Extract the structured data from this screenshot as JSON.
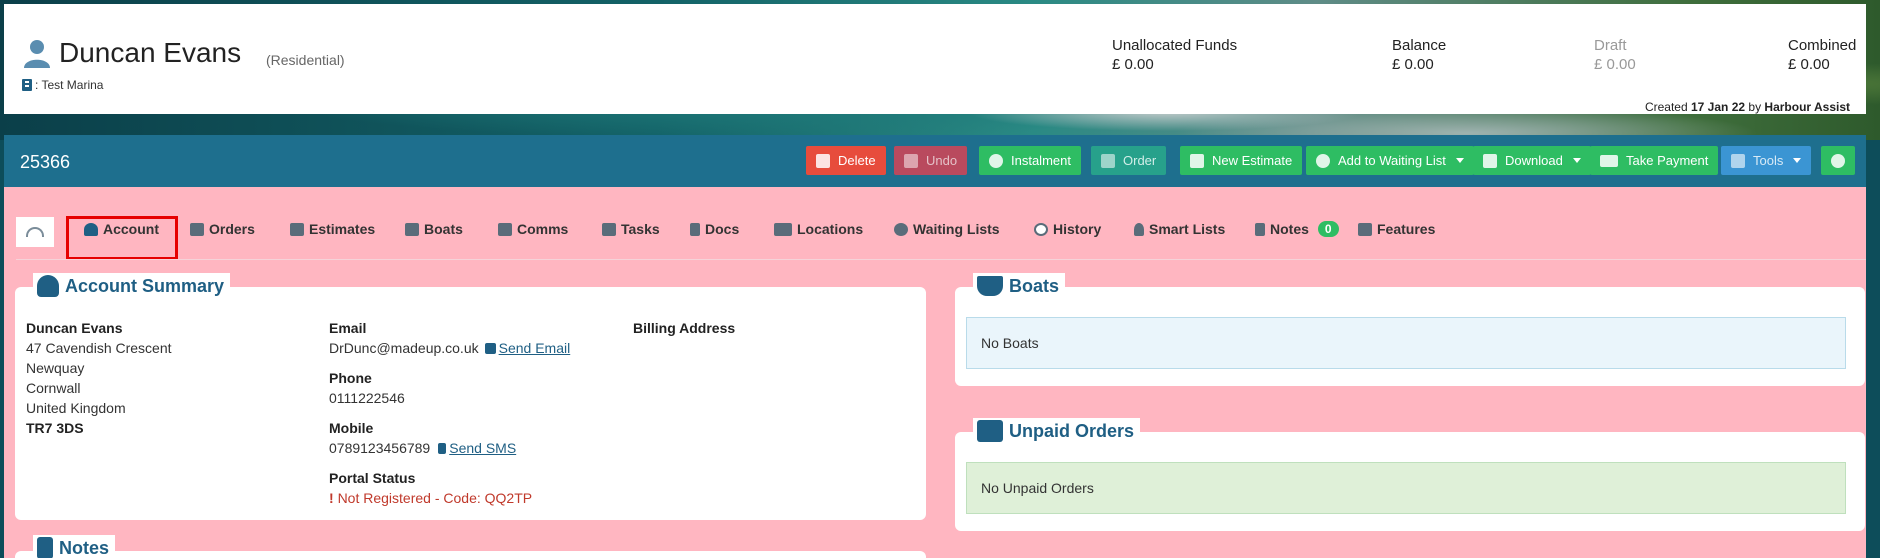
{
  "customer": {
    "name": "Duncan Evans",
    "type": "(Residential)",
    "marina": ": Test Marina"
  },
  "funds": [
    {
      "label": "Unallocated Funds",
      "value": "£ 0.00"
    },
    {
      "label": "Balance",
      "value": "£ 0.00"
    },
    {
      "label": "Draft",
      "value": "£ 0.00"
    },
    {
      "label": "Combined",
      "value": "£ 0.00"
    }
  ],
  "created": {
    "prefix": "Created",
    "date": "17 Jan 22",
    "by": "by",
    "author": "Harbour Assist"
  },
  "record_id": "25366",
  "actions": {
    "delete": "Delete",
    "undo": "Undo",
    "instalment": "Instalment",
    "order": "Order",
    "new_estimate": "New Estimate",
    "add_waiting_list": "Add to Waiting List",
    "download": "Download",
    "take_payment": "Take Payment",
    "tools": "Tools"
  },
  "tabs": {
    "account": "Account",
    "orders": "Orders",
    "estimates": "Estimates",
    "boats": "Boats",
    "comms": "Comms",
    "tasks": "Tasks",
    "docs": "Docs",
    "locations": "Locations",
    "waiting_lists": "Waiting Lists",
    "history": "History",
    "smart_lists": "Smart Lists",
    "notes": "Notes",
    "notes_count": "0",
    "features": "Features"
  },
  "account_summary": {
    "title": "Account Summary",
    "name": "Duncan Evans",
    "address": [
      "47 Cavendish Crescent",
      "Newquay",
      "Cornwall",
      "United Kingdom"
    ],
    "postcode": "TR7 3DS",
    "email_label": "Email",
    "email": "DrDunc@madeup.co.uk",
    "send_email": "Send Email",
    "phone_label": "Phone",
    "phone": "0111222546",
    "mobile_label": "Mobile",
    "mobile": "0789123456789",
    "send_sms": "Send SMS",
    "portal_label": "Portal Status",
    "portal_status": "Not Registered - Code: QQ2TP",
    "billing_label": "Billing Address"
  },
  "boats_panel": {
    "title": "Boats",
    "empty": "No Boats"
  },
  "unpaid_panel": {
    "title": "Unpaid Orders",
    "empty": "No Unpaid Orders"
  },
  "notes_panel": {
    "title": "Notes"
  },
  "colors": {
    "action_bar": "#1e6f8e",
    "main_bg": "#ffb6c1",
    "accent": "#1f5f84",
    "green": "#2ebd63",
    "red": "#e74c3c",
    "highlight": "#e60000"
  }
}
